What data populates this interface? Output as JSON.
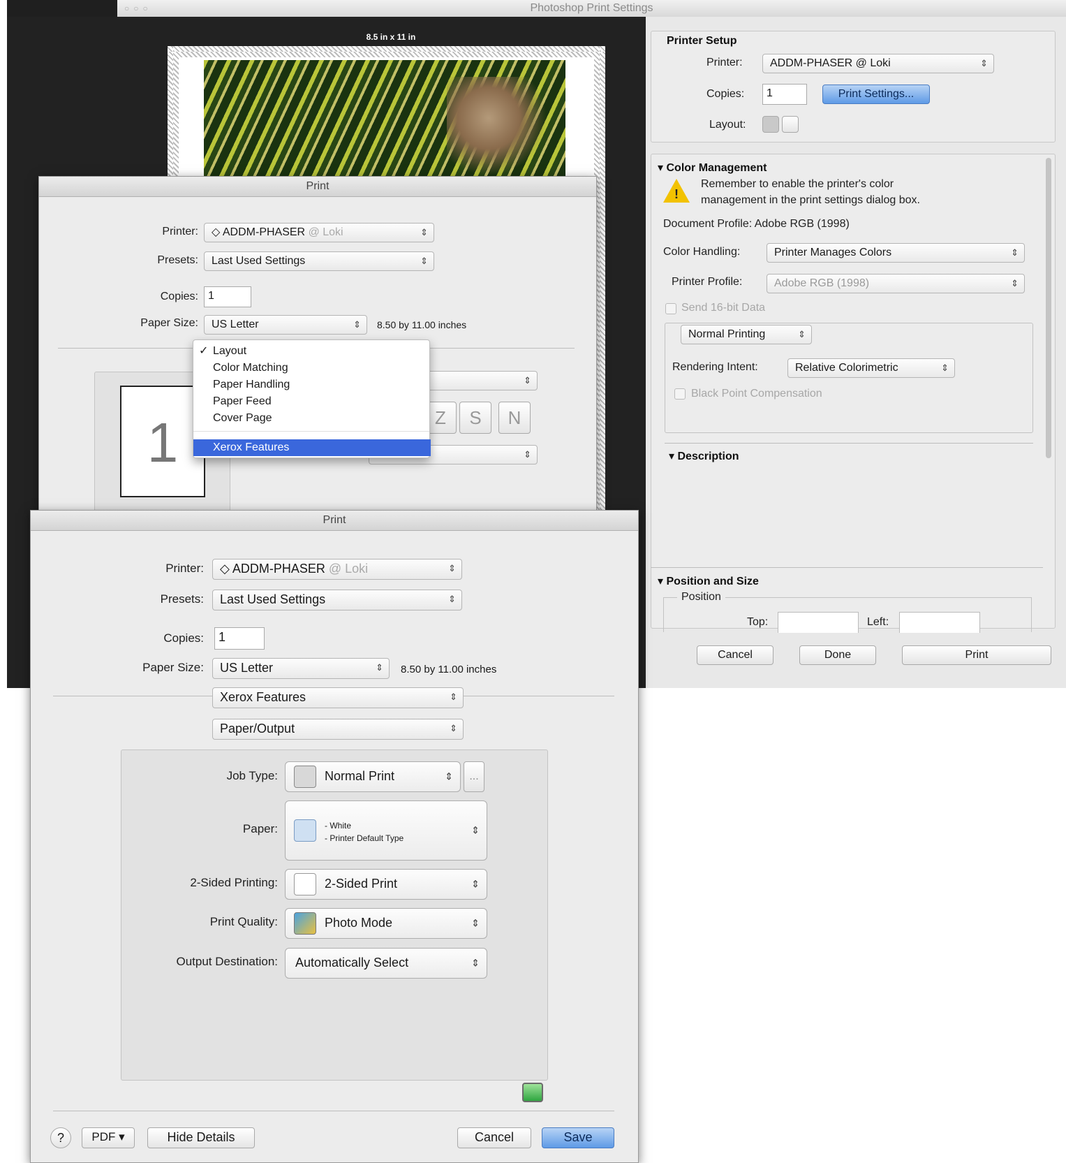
{
  "photoshop": {
    "window_title": "Photoshop Print Settings",
    "paper_size_label": "8.5 in x 11 in",
    "printer_setup": {
      "heading": "Printer Setup",
      "printer_label": "Printer:",
      "printer_value": "ADDM-PHASER @ Loki",
      "copies_label": "Copies:",
      "copies_value": "1",
      "print_settings_button": "Print Settings...",
      "layout_label": "Layout:"
    },
    "color_management": {
      "heading": "Color Management",
      "warning_line1": "Remember to enable the printer's color",
      "warning_line2": "management in the print settings dialog box.",
      "document_profile": "Document Profile: Adobe RGB (1998)",
      "color_handling_label": "Color Handling:",
      "color_handling_value": "Printer Manages Colors",
      "printer_profile_label": "Printer Profile:",
      "printer_profile_value": "Adobe RGB (1998)",
      "send16_label": "Send 16-bit Data",
      "normal_printing": "Normal Printing",
      "rendering_intent_label": "Rendering Intent:",
      "rendering_intent_value": "Relative Colorimetric",
      "black_point_label": "Black Point Compensation"
    },
    "description": {
      "heading": "Description"
    },
    "position_size": {
      "heading": "Position and Size",
      "position_label": "Position",
      "top_label": "Top:",
      "left_label": "Left:"
    },
    "buttons": {
      "cancel": "Cancel",
      "done": "Done",
      "print": "Print"
    }
  },
  "dialog1": {
    "title": "Print",
    "printer_label": "Printer:",
    "printer_value": "ADDM-PHASER",
    "printer_host": "@ Loki",
    "presets_label": "Presets:",
    "presets_value": "Last Used Settings",
    "copies_label": "Copies:",
    "copies_value": "1",
    "paper_size_label": "Paper Size:",
    "paper_size_value": "US Letter",
    "paper_dims": "8.50 by 11.00 inches",
    "page_number": "1",
    "menu": {
      "check": "✓",
      "items": [
        "Layout",
        "Color Matching",
        "Paper Handling",
        "Paper Feed",
        "Cover Page",
        "Xerox Features"
      ],
      "selected": "Xerox Features"
    }
  },
  "dialog2": {
    "title": "Print",
    "printer_label": "Printer:",
    "printer_value": "ADDM-PHASER",
    "printer_host": "@ Loki",
    "presets_label": "Presets:",
    "presets_value": "Last Used Settings",
    "copies_label": "Copies:",
    "copies_value": "1",
    "paper_size_label": "Paper Size:",
    "paper_size_value": "US Letter",
    "paper_dims": "8.50 by 11.00 inches",
    "panel_value": "Xerox Features",
    "subpanel_value": "Paper/Output",
    "job_type_label": "Job Type:",
    "job_type_value": "Normal Print",
    "more_button": "...",
    "paper_label": "Paper:",
    "paper_line1": "- White",
    "paper_line2": "- Printer Default Type",
    "two_sided_label": "2-Sided Printing:",
    "two_sided_value": "2-Sided Print",
    "print_quality_label": "Print Quality:",
    "print_quality_value": "Photo Mode",
    "output_dest_label": "Output Destination:",
    "output_dest_value": "Automatically Select",
    "help_button": "?",
    "pdf_button": "PDF",
    "hide_details_button": "Hide Details",
    "cancel_button": "Cancel",
    "save_button": "Save"
  },
  "colors": {
    "accent_blue": "#3a67dc",
    "default_button": "#5e9ae6",
    "warning": "#f2c200"
  }
}
